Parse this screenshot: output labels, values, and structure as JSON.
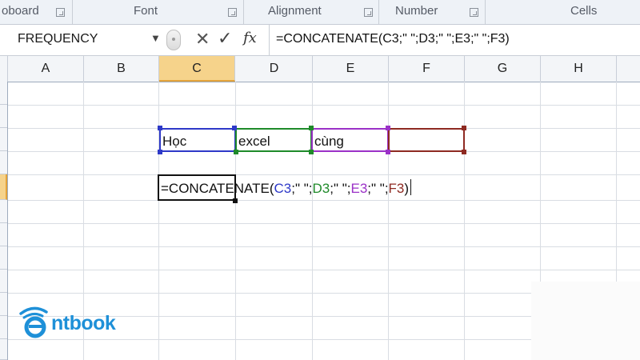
{
  "ribbon": {
    "groups": [
      {
        "label": "oboard"
      },
      {
        "label": "Font"
      },
      {
        "label": "Alignment"
      },
      {
        "label": "Number"
      },
      {
        "label": "Cells"
      }
    ]
  },
  "formula_bar": {
    "name_box": "FREQUENCY",
    "formula": "=CONCATENATE(C3;\" \";D3;\" \";E3;\" \";F3)"
  },
  "columns": [
    "A",
    "B",
    "C",
    "D",
    "E",
    "F",
    "G",
    "H"
  ],
  "active_column": "C",
  "cells": {
    "C3": "Học",
    "D3": "excel",
    "E3": "cùng",
    "F3": ""
  },
  "edit_formula": {
    "prefix": "=CONCATENATE(",
    "ref1": "C3",
    "sep1": ";\" \";",
    "ref2": "D3",
    "sep2": ";\" \";",
    "ref3": "E3",
    "sep3": ";\" \";",
    "ref4": "F3",
    "suffix": ")"
  },
  "colors": {
    "ref_c3": "#2e39c8",
    "ref_d3": "#1f8a2a",
    "ref_e3": "#9b31c7",
    "ref_f3": "#8e2a22",
    "brand": "#1e90d8"
  },
  "logo": {
    "text": "ntbook"
  }
}
